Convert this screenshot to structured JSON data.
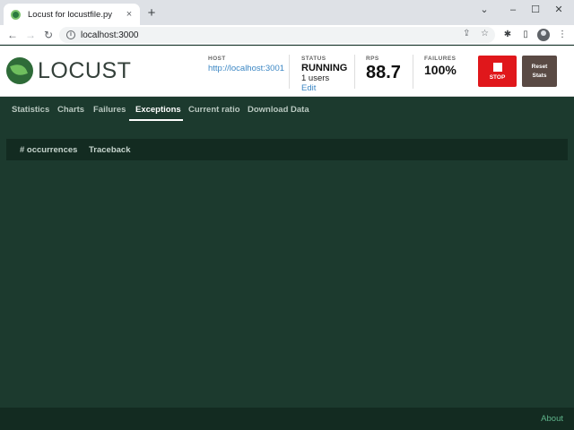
{
  "browser": {
    "tab_title": "Locust for locustfile.py",
    "tab_close": "×",
    "new_tab": "+",
    "url": "localhost:3000",
    "window_controls": {
      "minimize": "⌄",
      "restore": "–",
      "maximize": "☐",
      "close": "✕"
    }
  },
  "header": {
    "logo_text": "LOCUST",
    "host": {
      "label": "HOST",
      "value": "http://localhost:3001"
    },
    "status": {
      "label": "STATUS",
      "value": "RUNNING",
      "users": "1 users",
      "edit": "Edit"
    },
    "rps": {
      "label": "RPS",
      "value": "88.7"
    },
    "failures": {
      "label": "FAILURES",
      "value": "100%"
    },
    "stop_label": "STOP",
    "reset_label_1": "Reset",
    "reset_label_2": "Stats"
  },
  "tabs": [
    {
      "label": "Statistics"
    },
    {
      "label": "Charts"
    },
    {
      "label": "Failures"
    },
    {
      "label": "Exceptions",
      "active": true
    },
    {
      "label": "Current ratio"
    },
    {
      "label": "Download Data"
    }
  ],
  "table": {
    "columns": [
      "# occurrences",
      "Traceback"
    ],
    "rows": []
  },
  "footer": {
    "about": "About"
  },
  "colors": {
    "background": "#1c3a2e",
    "table_header": "#132b21",
    "stop": "#e0171b",
    "reset": "#5a4a44",
    "link": "#3c87c4"
  }
}
